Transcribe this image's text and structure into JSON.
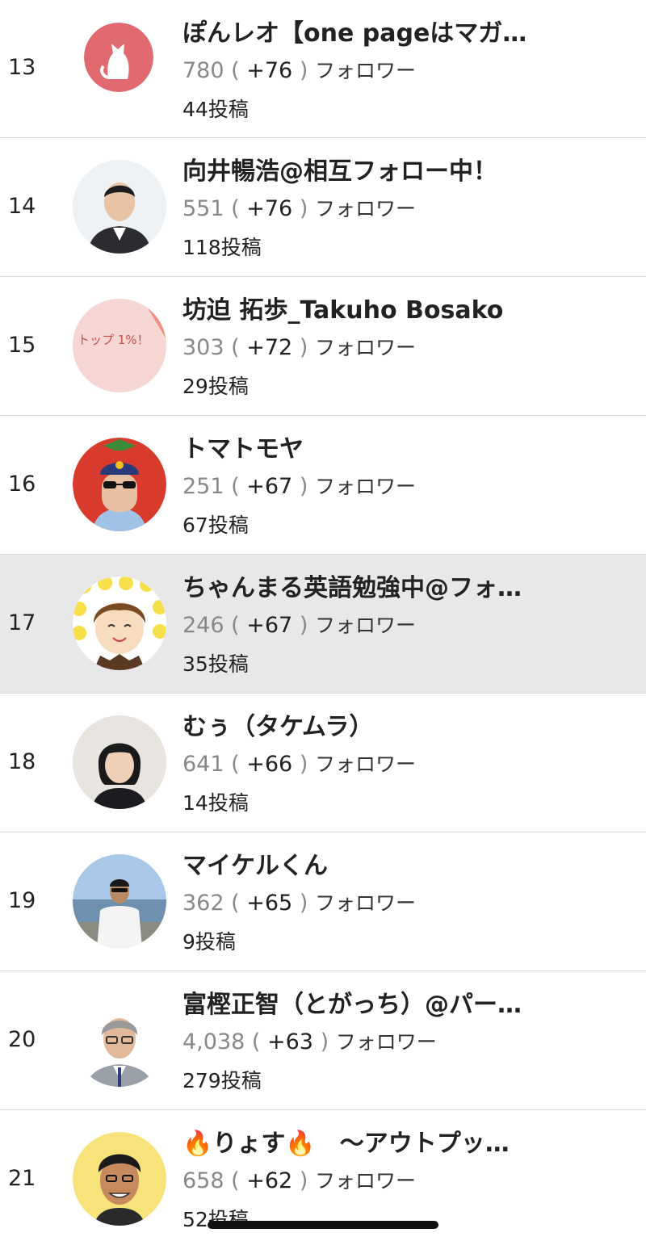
{
  "labels": {
    "followers_unit": "フォロワー",
    "posts_unit": "投稿"
  },
  "users": [
    {
      "rank": "13",
      "name": "ぽんレオ【one pageはマガ…",
      "followers": "780",
      "delta": "+76",
      "posts": "44",
      "avatar_icon": "cat-icon",
      "highlighted": false
    },
    {
      "rank": "14",
      "name": "向井暢浩@相互フォロー中！",
      "followers": "551",
      "delta": "+76",
      "posts": "118",
      "avatar_icon": "man-suit-photo",
      "highlighted": false
    },
    {
      "rank": "15",
      "name": "坊迫 拓歩_Takuho Bosako",
      "followers": "303",
      "delta": "+72",
      "posts": "29",
      "avatar_icon": "top-badge-image",
      "avatar_text": "トップ 1%！",
      "highlighted": false
    },
    {
      "rank": "16",
      "name": "トマトモヤ",
      "followers": "251",
      "delta": "+67",
      "posts": "67",
      "avatar_icon": "tomato-man-illustration",
      "highlighted": false
    },
    {
      "rank": "17",
      "name": "ちゃんまる英語勉強中@フォ…",
      "followers": "246",
      "delta": "+67",
      "posts": "35",
      "avatar_icon": "smiling-boy-illustration",
      "highlighted": true
    },
    {
      "rank": "18",
      "name": "むぅ（タケムラ）",
      "followers": "641",
      "delta": "+66",
      "posts": "14",
      "avatar_icon": "woman-photo",
      "highlighted": false
    },
    {
      "rank": "19",
      "name": "マイケルくん",
      "followers": "362",
      "delta": "+65",
      "posts": "9",
      "avatar_icon": "man-seaside-photo",
      "highlighted": false
    },
    {
      "rank": "20",
      "name": "富樫正智（とがっち）@パー…",
      "followers": "4,038",
      "delta": "+63",
      "posts": "279",
      "avatar_icon": "man-glasses-photo",
      "highlighted": false
    },
    {
      "rank": "21",
      "name": "🔥りょす🔥　～アウトプッ…",
      "followers": "658",
      "delta": "+62",
      "posts": "52",
      "avatar_icon": "caricature-man-illustration",
      "highlighted": false
    }
  ],
  "colors": {
    "highlight": "#e8e8e8",
    "divider": "#d8d8d8",
    "muted": "#888888",
    "cat_bg": "#e06a70",
    "tomato": "#d83a2c"
  }
}
